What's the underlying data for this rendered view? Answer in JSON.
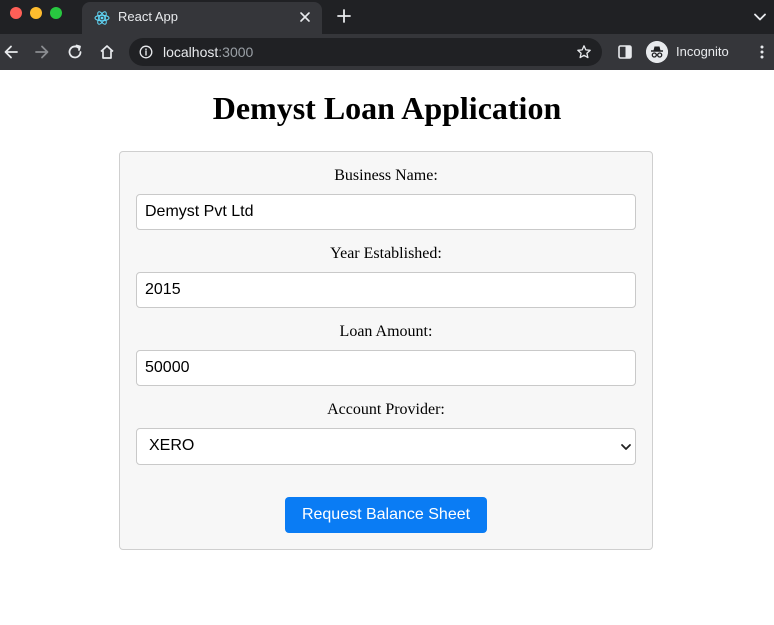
{
  "browser": {
    "tab": {
      "title": "React App",
      "favicon": "react-logo-icon"
    },
    "address": {
      "host": "localhost",
      "port": ":3000"
    },
    "profile_label": "Incognito"
  },
  "page": {
    "title": "Demyst Loan Application",
    "form": {
      "business_name": {
        "label": "Business Name:",
        "value": "Demyst Pvt Ltd"
      },
      "year_established": {
        "label": "Year Established:",
        "value": "2015"
      },
      "loan_amount": {
        "label": "Loan Amount:",
        "value": "50000"
      },
      "account_provider": {
        "label": "Account Provider:",
        "selected": "XERO"
      },
      "submit_label": "Request Balance Sheet"
    }
  },
  "colors": {
    "tabbar_bg": "#202124",
    "toolbar_bg": "#35363a",
    "card_bg": "#f7f7f7",
    "button_bg": "#0a7cf4"
  }
}
